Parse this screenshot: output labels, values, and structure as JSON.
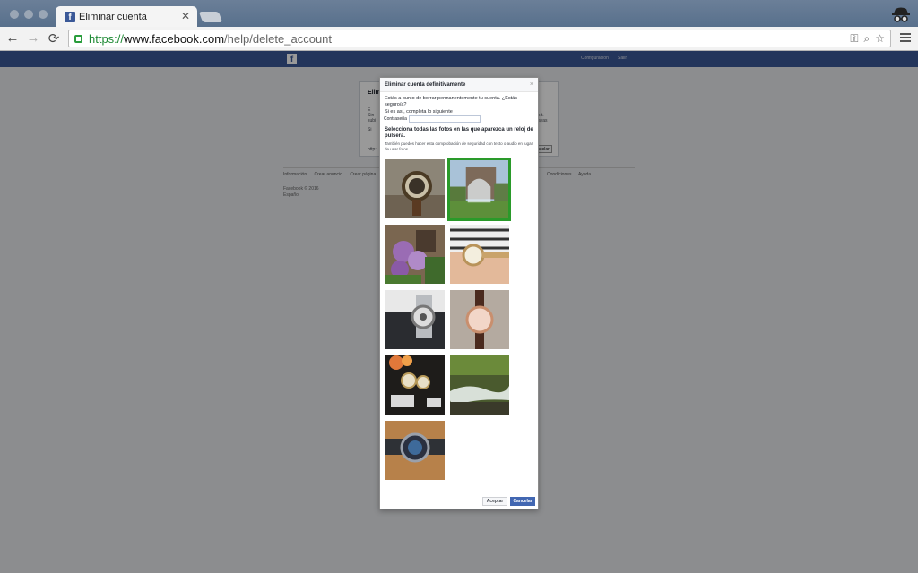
{
  "browser": {
    "tab_title": "Eliminar cuenta",
    "tab_close": "✕",
    "url_protocol": "https://",
    "url_host": "www.facebook.com",
    "url_path": "/help/delete_account",
    "back_icon": "←",
    "forward_icon": "→",
    "reload_icon": "⟳",
    "key_icon": "⚿",
    "search_icon": "⌕",
    "star_icon": "☆"
  },
  "fb_header": {
    "logo": "f",
    "link_settings": "Configuración",
    "link_logout": "Salir"
  },
  "background_card": {
    "title": "Elimi",
    "line1": "E",
    "line2": "Sin",
    "line3": "subi",
    "line4": "Si",
    "tail1": "s t.",
    "tail2": "ayas",
    "input_hint": "http:",
    "cancel_btn": "ncelar"
  },
  "footer": {
    "links": [
      "Información",
      "Crear anuncio",
      "Crear página",
      "Condiciones",
      "Ayuda"
    ],
    "copyright": "Facebook © 2016",
    "language": "Español"
  },
  "dialog": {
    "title": "Eliminar cuenta definitivamente",
    "close": "×",
    "intro": "Estás a punto de borrar permanentemente tu cuenta. ¿Estás seguro/a?",
    "intro2": "Si es así, completa lo siguiente",
    "password_label": "Contraseña",
    "question": "Selecciona todas las fotos en las que aparezca un reloj de pulsera.",
    "alt_text": "También puedes hacer esta comprobación de seguridad con texto o audio en lugar de usar fotos.",
    "accept_button": "Aceptar",
    "cancel_button": "Cancelar"
  },
  "photos": [
    {
      "name": "watch-on-stone",
      "selected": false
    },
    {
      "name": "fountain-building",
      "selected": true
    },
    {
      "name": "lilac-flowers",
      "selected": false
    },
    {
      "name": "watch-on-wrist-stripes",
      "selected": false
    },
    {
      "name": "watch-in-box",
      "selected": false
    },
    {
      "name": "pink-watch",
      "selected": false
    },
    {
      "name": "watches-with-flowers",
      "selected": false
    },
    {
      "name": "waterfall-stream",
      "selected": false
    },
    {
      "name": "blue-dial-watch",
      "selected": false
    }
  ],
  "colors": {
    "facebook_blue": "#3b5998",
    "selection_green": "#2a9a2a",
    "url_green": "#1e8a34"
  }
}
